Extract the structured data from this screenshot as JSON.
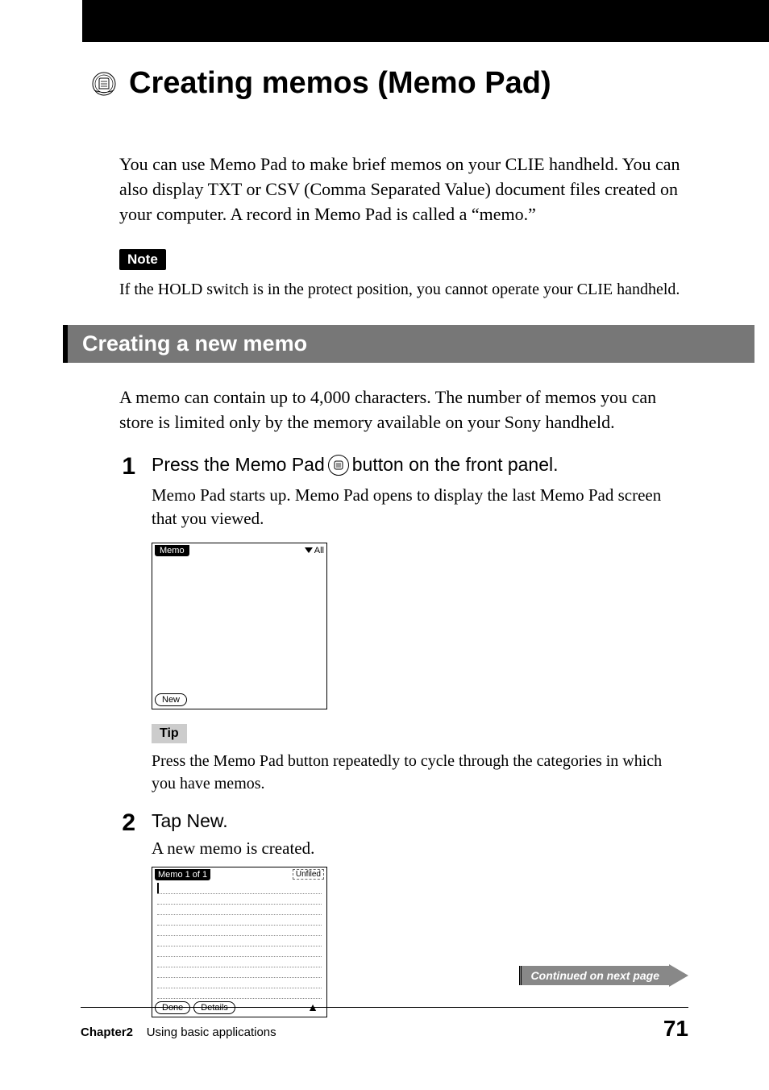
{
  "title": "Creating memos (Memo Pad)",
  "intro": "You can use Memo Pad to make brief memos on your CLIE handheld. You can also display TXT or CSV (Comma Separated Value) document files created on your computer. A record in Memo Pad is called a “memo.”",
  "note": {
    "label": "Note",
    "text": "If the HOLD switch is in the protect position, you cannot operate your CLIE handheld."
  },
  "section": {
    "heading": "Creating a new memo",
    "intro": "A memo can contain up to 4,000 characters. The number of memos you can store is limited only by the memory available on your Sony handheld."
  },
  "steps": {
    "s1": {
      "num": "1",
      "title_a": "Press the Memo Pad ",
      "title_b": " button on the front panel.",
      "desc": "Memo Pad starts up. Memo Pad opens to display the last Memo Pad screen that you viewed.",
      "shot": {
        "tab": "Memo",
        "category": "All",
        "new_btn": "New"
      },
      "tip": {
        "label": "Tip",
        "text": "Press the Memo Pad button repeatedly to cycle through the categories in which you have memos."
      }
    },
    "s2": {
      "num": "2",
      "title": "Tap New.",
      "desc": "A new memo is created.",
      "shot": {
        "tab": "Memo 1 of 1",
        "category": "Unfiled",
        "done_btn": "Done",
        "details_btn": "Details"
      }
    }
  },
  "continued": "Continued on next page",
  "footer": {
    "chapter": "Chapter2",
    "label": "Using basic applications",
    "page": "71"
  }
}
